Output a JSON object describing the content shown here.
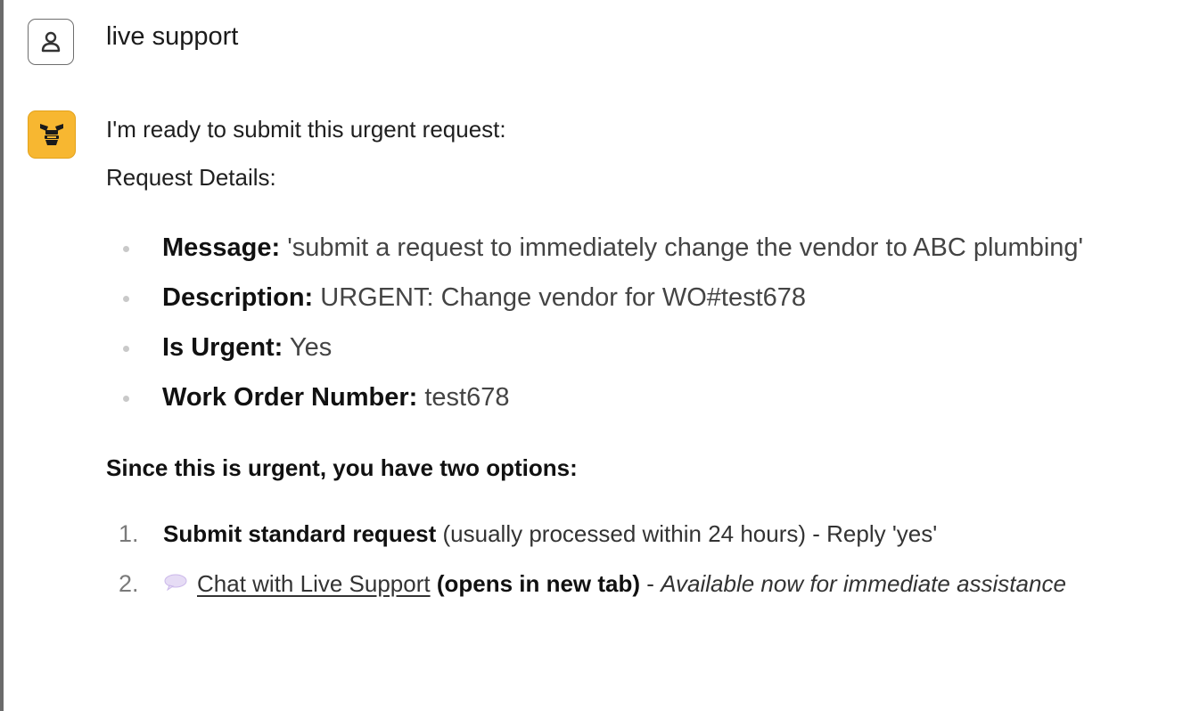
{
  "user_message": {
    "avatar_icon": "user-icon",
    "text": "live support"
  },
  "bot_message": {
    "avatar_icon": "bee-logo-icon",
    "avatar_color": "#f7b731",
    "intro": "I'm ready to submit this urgent request:",
    "details_label": "Request Details:",
    "details": [
      {
        "key": "Message:",
        "value": "'submit a request to immediately change the vendor to ABC plumbing'"
      },
      {
        "key": "Description:",
        "value": "URGENT: Change vendor for WO#test678"
      },
      {
        "key": "Is Urgent:",
        "value": "Yes"
      },
      {
        "key": "Work Order Number:",
        "value": "test678"
      }
    ],
    "options_heading": "Since this is urgent, you have two options:",
    "options": [
      {
        "number": "1.",
        "strong": "Submit standard request",
        "rest": " (usually processed within 24 hours) - Reply 'yes'"
      },
      {
        "number": "2.",
        "icon": "speech-bubble-icon",
        "link": "Chat with Live Support",
        "strong": " (opens in new tab)",
        "dash": " - ",
        "italic": "Available now for immediate assistance"
      }
    ]
  }
}
